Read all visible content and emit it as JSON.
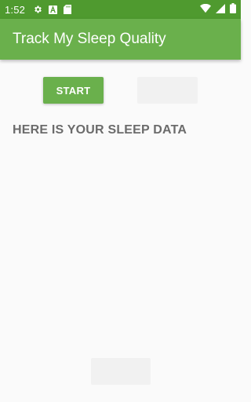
{
  "status_bar": {
    "time": "1:52",
    "icons": [
      "gear-icon",
      "font-a-icon",
      "sd-card-icon",
      "wifi-icon",
      "cellular-signal-icon",
      "battery-icon"
    ]
  },
  "app_bar": {
    "title": "Track My Sleep Quality"
  },
  "controls": {
    "start_label": "START",
    "stop_label": "",
    "clear_label": ""
  },
  "content": {
    "heading": "HERE IS YOUR SLEEP DATA"
  },
  "colors": {
    "status_bar": "#4f9a2f",
    "primary": "#6ab04c",
    "background": "#fafafa",
    "heading_text": "#6b6b6b",
    "disabled_button": "#f1f1f1"
  }
}
